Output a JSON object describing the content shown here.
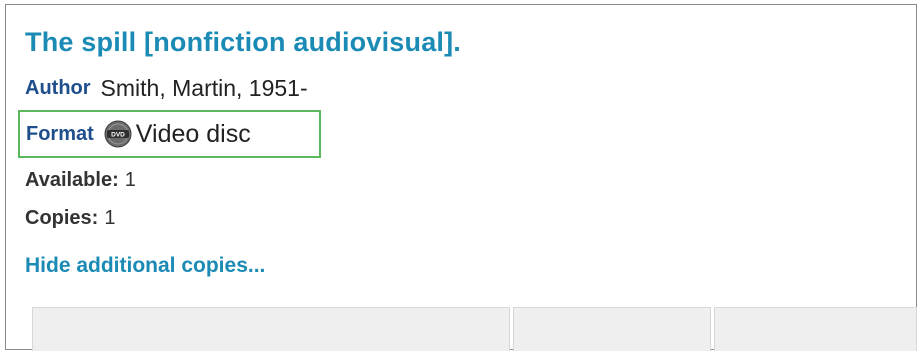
{
  "record": {
    "title": "The spill [nonfiction audiovisual].",
    "author_label": "Author",
    "author_value": "Smith, Martin, 1951-",
    "format_label": "Format",
    "format_icon": "dvd-disc-icon",
    "format_icon_text": "DVD",
    "format_value": "Video disc",
    "available_label": "Available:",
    "available_value": "1",
    "copies_label": "Copies:",
    "copies_value": "1",
    "hide_copies_link": "Hide additional copies..."
  },
  "colors": {
    "title_link": "#1b8bb5",
    "label_blue": "#1f4e8c",
    "highlight_box": "#5cb85c",
    "panel_bg": "#efefef"
  }
}
